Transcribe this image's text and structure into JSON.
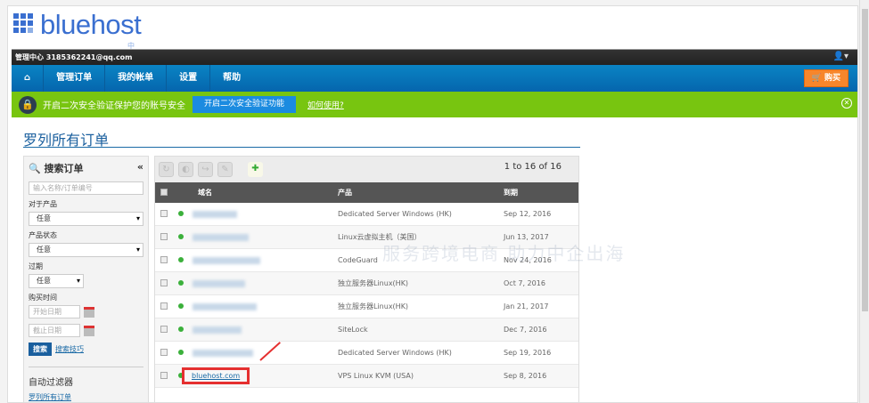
{
  "logo": {
    "brand": "bluehost",
    "region": "中国"
  },
  "topbar": {
    "account": "管理中心 3185362241@qq.com"
  },
  "nav": {
    "items": [
      "管理订单",
      "我的帐单",
      "设置",
      "帮助"
    ],
    "buy": "购买"
  },
  "alert": {
    "text": "开启二次安全验证保护您的账号安全",
    "button": "开启二次安全验证功能",
    "link": "如何使用?"
  },
  "page": {
    "title": "罗列所有订单"
  },
  "sidebar": {
    "title": "搜索订单",
    "search_placeholder": "输入名称/订单编号",
    "product_label": "对于产品",
    "product_value": "任意",
    "status_label": "产品状态",
    "status_value": "任意",
    "expire_label": "过期",
    "expire_value": "任意",
    "date_label": "购买时间",
    "start_placeholder": "开始日期",
    "end_placeholder": "截止日期",
    "search_button": "搜索",
    "tips_link": "搜索技巧",
    "auto_filter": "自动过滤器",
    "list_all_link": "罗列所有订单"
  },
  "table": {
    "pagination": "1 to 16 of 16",
    "headers": [
      "域名",
      "产品",
      "到期"
    ],
    "rows": [
      {
        "domain": "",
        "product": "Dedicated Server Windows (HK)",
        "expires": "Sep 12, 2016"
      },
      {
        "domain": "",
        "product": "Linux云虚拟主机（美国）",
        "expires": "Jun 13, 2017"
      },
      {
        "domain": "",
        "product": "CodeGuard",
        "expires": "Nov 24, 2016"
      },
      {
        "domain": "",
        "product": "独立服务器Linux(HK)",
        "expires": "Oct 7, 2016"
      },
      {
        "domain": "",
        "product": "独立服务器Linux(HK)",
        "expires": "Jan 21, 2017"
      },
      {
        "domain": "",
        "product": "SiteLock",
        "expires": "Dec 7, 2016"
      },
      {
        "domain": "",
        "product": "Dedicated Server Windows (HK)",
        "expires": "Sep 19, 2016"
      },
      {
        "domain": "bluehost.com",
        "product": "VPS Linux KVM (USA)",
        "expires": "Sep 8, 2016"
      }
    ]
  },
  "watermark": {
    "text": "服务跨境电商 助力中企出海"
  }
}
